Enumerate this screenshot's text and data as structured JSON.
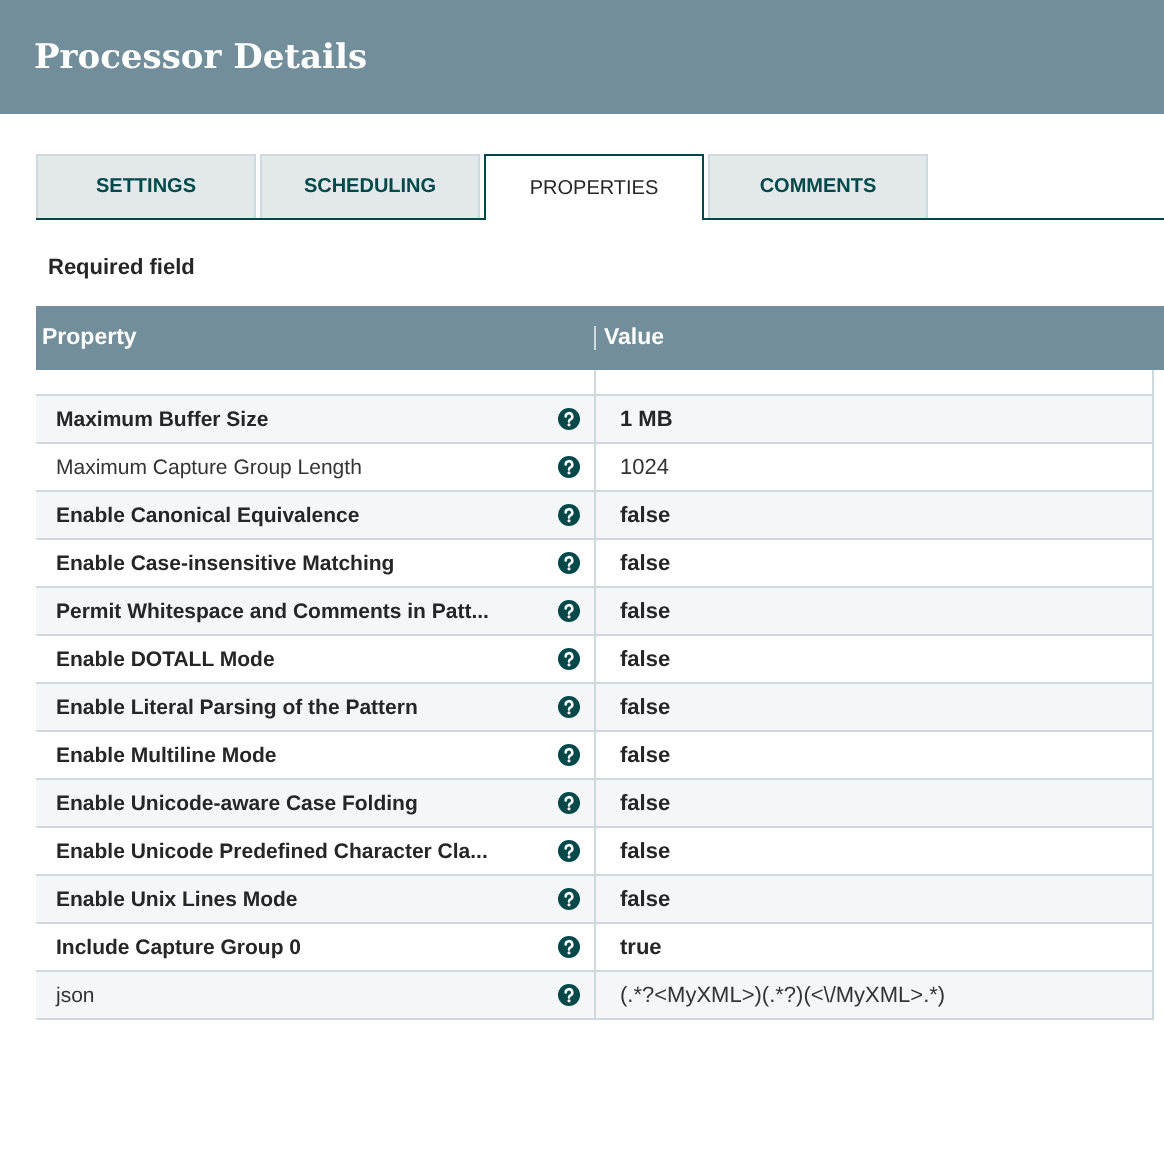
{
  "dialog": {
    "title": "Processor Details"
  },
  "tabs": [
    {
      "label": "SETTINGS",
      "selected": false
    },
    {
      "label": "SCHEDULING",
      "selected": false
    },
    {
      "label": "PROPERTIES",
      "selected": true
    },
    {
      "label": "COMMENTS",
      "selected": false
    }
  ],
  "required_note": "Required field",
  "table": {
    "columns": [
      "Property",
      "Value"
    ],
    "rows": [
      {
        "property": "Maximum Buffer Size",
        "value": "1 MB",
        "required": true
      },
      {
        "property": "Maximum Capture Group Length",
        "value": "1024",
        "required": false
      },
      {
        "property": "Enable Canonical Equivalence",
        "value": "false",
        "required": true
      },
      {
        "property": "Enable Case-insensitive Matching",
        "value": "false",
        "required": true
      },
      {
        "property": "Permit Whitespace and Comments in Patt...",
        "value": "false",
        "required": true
      },
      {
        "property": "Enable DOTALL Mode",
        "value": "false",
        "required": true
      },
      {
        "property": "Enable Literal Parsing of the Pattern",
        "value": "false",
        "required": true
      },
      {
        "property": "Enable Multiline Mode",
        "value": "false",
        "required": true
      },
      {
        "property": "Enable Unicode-aware Case Folding",
        "value": "false",
        "required": true
      },
      {
        "property": "Enable Unicode Predefined Character Cla...",
        "value": "false",
        "required": true
      },
      {
        "property": "Enable Unix Lines Mode",
        "value": "false",
        "required": true
      },
      {
        "property": "Include Capture Group 0",
        "value": "true",
        "required": true
      },
      {
        "property": "json",
        "value": "(.*?<MyXML>)(.*?)(<\\/MyXML>.*)",
        "required": false
      }
    ]
  }
}
